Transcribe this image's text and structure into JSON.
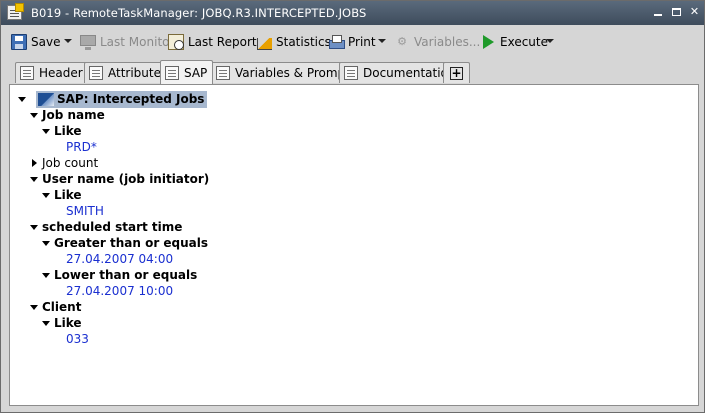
{
  "window": {
    "title": "B019 - RemoteTaskManager: JOBQ.R3.INTERCEPTED.JOBS"
  },
  "toolbar": {
    "save_label": "Save",
    "last_monitor_label": "Last Monitor",
    "last_report_label": "Last Report",
    "statistics_label": "Statistics",
    "print_label": "Print",
    "variables_label": "Variables...",
    "execute_label": "Execute"
  },
  "tabs": [
    {
      "label": "Header"
    },
    {
      "label": "Attributes"
    },
    {
      "label": "SAP",
      "active": true
    },
    {
      "label": "Variables & Prompts"
    },
    {
      "label": "Documentation"
    },
    {
      "label": "+"
    }
  ],
  "tree": {
    "root": "SAP: Intercepted Jobs",
    "job_name": "Job name",
    "job_name_like": "Like",
    "job_name_value": "PRD*",
    "job_count": "Job count",
    "user_name": "User name (job initiator)",
    "user_name_like": "Like",
    "user_name_value": "SMITH",
    "start_time": "scheduled start time",
    "gte": "Greater than or equals",
    "gte_value": "27.04.2007  04:00",
    "lte": "Lower than or equals",
    "lte_value": "27.04.2007  10:00",
    "client": "Client",
    "client_like": "Like",
    "client_value": "033"
  },
  "colors": {
    "titlebar": "#4a5a6c",
    "value_text": "#1a2fd0",
    "selection": "#a7b8cf"
  }
}
